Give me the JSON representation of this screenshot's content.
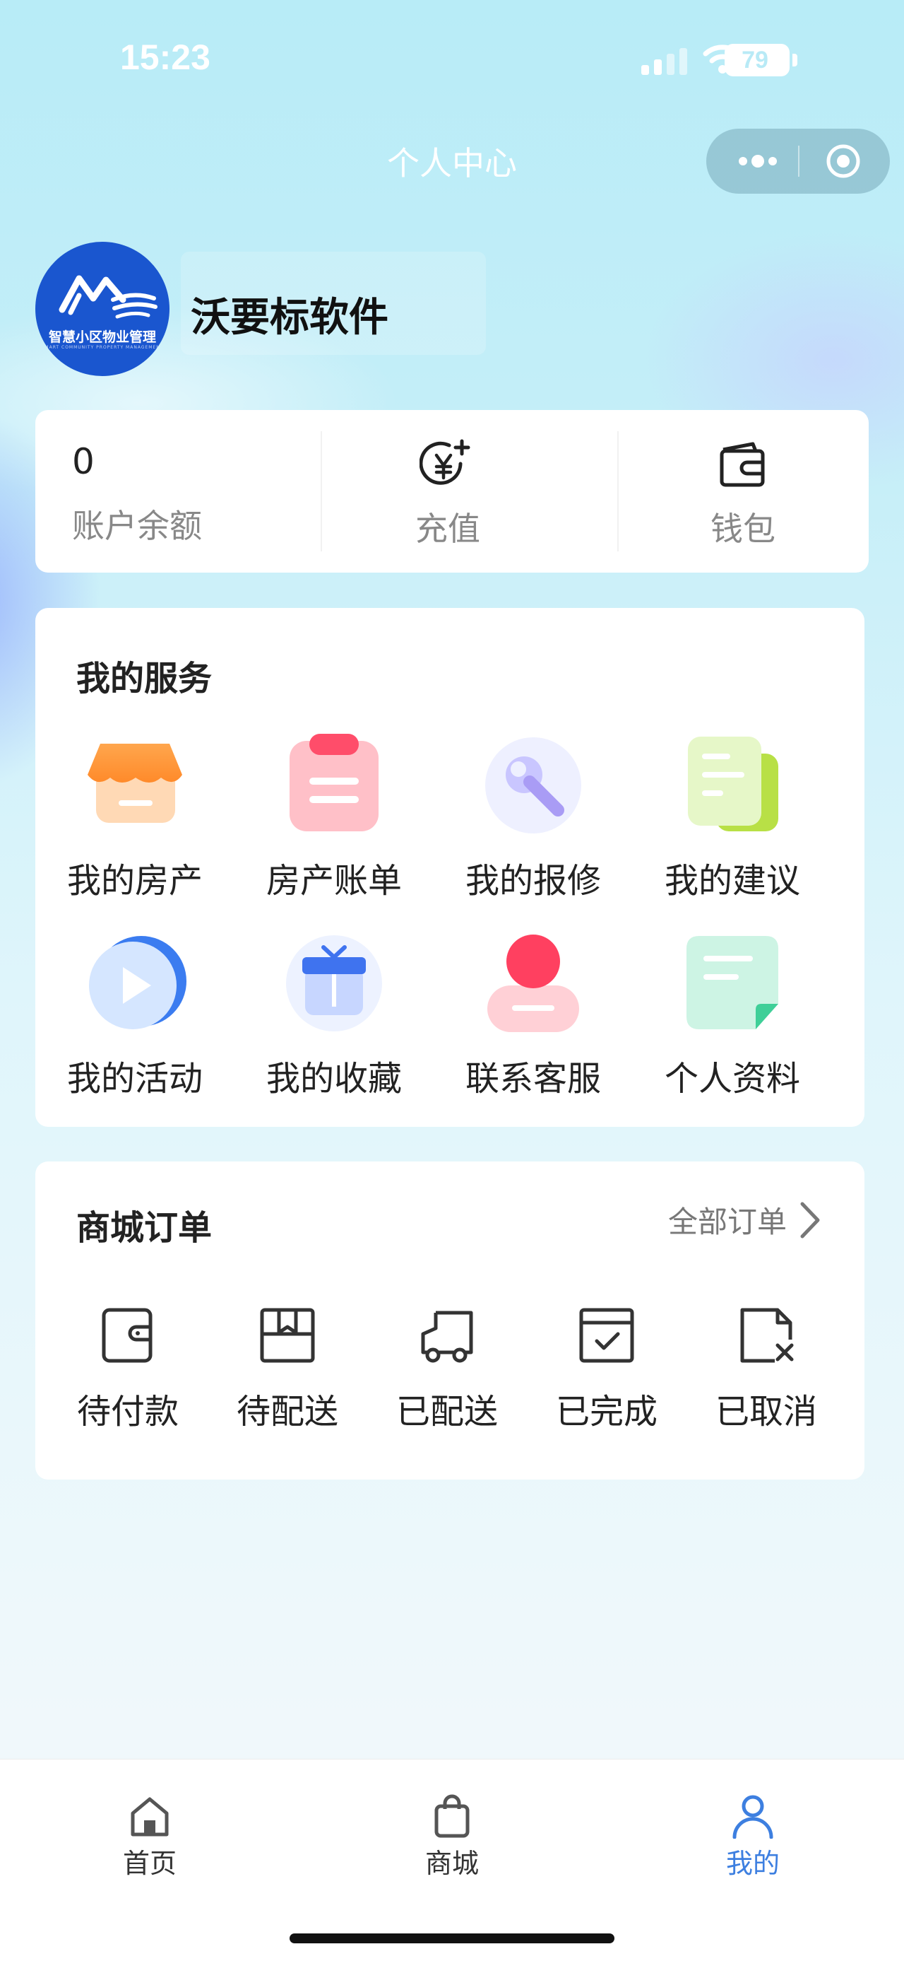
{
  "status_bar": {
    "time": "15:23",
    "battery": "79"
  },
  "nav": {
    "title": "个人中心"
  },
  "profile": {
    "name": "沃要标软件",
    "logo_text": "智慧小区物业管理",
    "logo_subtext": "SMART COMMUNITY PROPERTY MANAGEMENT"
  },
  "account": {
    "balance_value": "0",
    "balance_label": "账户余额",
    "recharge_label": "充值",
    "wallet_label": "钱包"
  },
  "services": {
    "title": "我的服务",
    "items": [
      {
        "label": "我的房产",
        "icon": "house-shop-icon"
      },
      {
        "label": "房产账单",
        "icon": "bill-icon"
      },
      {
        "label": "我的报修",
        "icon": "wrench-icon"
      },
      {
        "label": "我的建议",
        "icon": "suggestion-icon"
      },
      {
        "label": "我的活动",
        "icon": "play-icon"
      },
      {
        "label": "我的收藏",
        "icon": "gift-icon"
      },
      {
        "label": "联系客服",
        "icon": "customer-service-icon"
      },
      {
        "label": "个人资料",
        "icon": "profile-doc-icon"
      }
    ]
  },
  "orders": {
    "title": "商城订单",
    "all_label": "全部订单",
    "items": [
      {
        "label": "待付款",
        "icon": "wallet-icon"
      },
      {
        "label": "待配送",
        "icon": "package-icon"
      },
      {
        "label": "已配送",
        "icon": "truck-icon"
      },
      {
        "label": "已完成",
        "icon": "calendar-check-icon"
      },
      {
        "label": "已取消",
        "icon": "doc-cancel-icon"
      }
    ]
  },
  "tabbar": {
    "items": [
      {
        "label": "首页",
        "icon": "home-icon",
        "active": false
      },
      {
        "label": "商城",
        "icon": "shopping-bag-icon",
        "active": false
      },
      {
        "label": "我的",
        "icon": "user-icon",
        "active": true
      }
    ]
  },
  "colors": {
    "accent": "#3d7fe0",
    "avatar_bg": "#1a56cf"
  }
}
